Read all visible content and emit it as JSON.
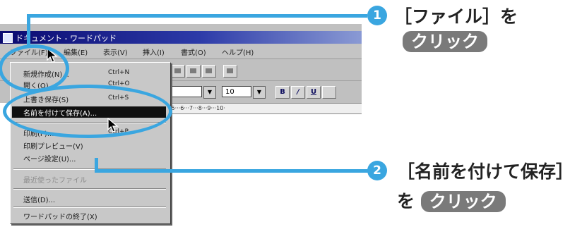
{
  "window": {
    "title": "ドキュメント - ワードパッド"
  },
  "menubar": [
    "ファイル(F)",
    "編集(E)",
    "表示(V)",
    "挿入(I)",
    "書式(O)",
    "ヘルプ(H)"
  ],
  "file_menu": {
    "items": [
      {
        "label": "新規作成(N)...",
        "shortcut": "Ctrl+N"
      },
      {
        "label": "開く(O)...",
        "shortcut": "Ctrl+O"
      },
      {
        "label": "上書き保存(S)",
        "shortcut": "Ctrl+S"
      },
      {
        "label": "名前を付けて保存(A)..."
      },
      {
        "label": "印刷(P)...",
        "shortcut": "Ctrl+P"
      },
      {
        "label": "印刷プレビュー(V)"
      },
      {
        "label": "ページ設定(U)..."
      },
      {
        "label": "最近使ったファイル"
      },
      {
        "label": "送信(D)..."
      },
      {
        "label": "ワードパッドの終了(X)"
      }
    ]
  },
  "format_bar": {
    "font_size": "10",
    "bold": "B",
    "italic": "/",
    "underline": "U"
  },
  "ruler": "·5···6···7···8···9···10·",
  "callouts": {
    "step1": {
      "number": "1",
      "line1": "［ファイル］を",
      "action": "クリック"
    },
    "step2": {
      "number": "2",
      "line1": "［名前を付けて保存］",
      "prefix": "を",
      "action": "クリック"
    }
  },
  "colors": {
    "accent": "#3aa6e0",
    "pill": "#7a7a7a",
    "highlight": "#101010"
  }
}
